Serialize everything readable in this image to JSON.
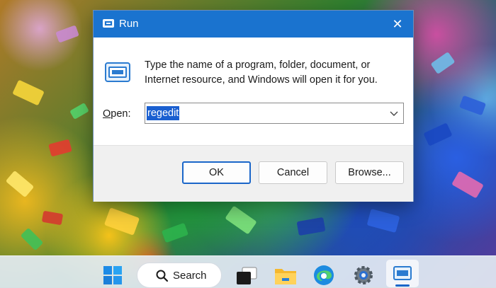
{
  "dialog": {
    "title": "Run",
    "close_glyph": "✕",
    "description": "Type the name of a program, folder, document, or Internet resource, and Windows will open it for you.",
    "open_label_accel": "O",
    "open_label_rest": "pen:",
    "open_value": "regedit",
    "buttons": {
      "ok": "OK",
      "cancel": "Cancel",
      "browse": "Browse..."
    }
  },
  "taskbar": {
    "search_label": "Search",
    "items": [
      "windows-start-icon",
      "search-icon",
      "task-view-icon",
      "file-explorer-icon",
      "edge-icon",
      "settings-icon",
      "run-icon"
    ]
  },
  "colors": {
    "titlebar": "#1a73cf",
    "selection": "#1a5fd0",
    "default_button_border": "#1a66c9"
  }
}
